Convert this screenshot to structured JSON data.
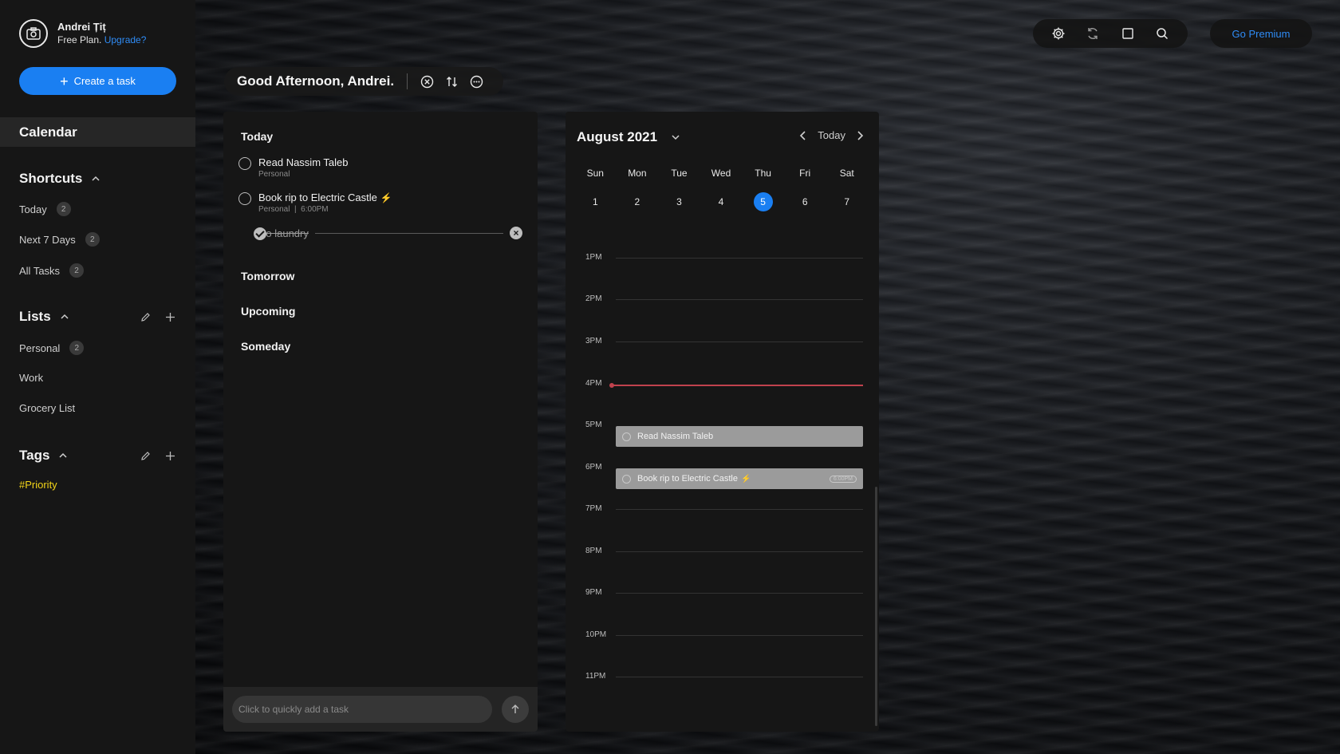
{
  "profile": {
    "name": "Andrei Țiț",
    "plan": "Free Plan.",
    "upgrade": "Upgrade?"
  },
  "sidebar": {
    "create_task": "Create a task",
    "calendar": "Calendar",
    "shortcuts_title": "Shortcuts",
    "shortcuts": [
      {
        "label": "Today",
        "count": "2"
      },
      {
        "label": "Next 7 Days",
        "count": "2"
      },
      {
        "label": "All Tasks",
        "count": "2"
      }
    ],
    "lists_title": "Lists",
    "lists": [
      {
        "label": "Personal",
        "count": "2"
      },
      {
        "label": "Work"
      },
      {
        "label": "Grocery List"
      }
    ],
    "tags_title": "Tags",
    "tags": [
      {
        "label": "#Priority",
        "color": "#f2d418"
      }
    ]
  },
  "greeting": {
    "text": "Good Afternoon, Andrei."
  },
  "toolbar": {
    "premium": "Go Premium",
    "icons": [
      "settings-icon",
      "sync-icon",
      "window-icon",
      "search-icon"
    ]
  },
  "tasks": {
    "groups": {
      "today": "Today",
      "tomorrow": "Tomorrow",
      "upcoming": "Upcoming",
      "someday": "Someday"
    },
    "items": [
      {
        "title": "Read Nassim Taleb",
        "meta": "Personal",
        "done": false
      },
      {
        "title": "Book rip to Electric Castle",
        "meta": "Personal  |  6:00PM",
        "done": false,
        "priority": "⚡"
      },
      {
        "title": "Do laundry",
        "done": true
      }
    ],
    "quick_add_placeholder": "Click to quickly add a task"
  },
  "calendar": {
    "month": "August 2021",
    "today_label": "Today",
    "weekdays": [
      "Sun",
      "Mon",
      "Tue",
      "Wed",
      "Thu",
      "Fri",
      "Sat"
    ],
    "dates": [
      "1",
      "2",
      "3",
      "4",
      "5",
      "6",
      "7"
    ],
    "selected_date": "5",
    "hours": [
      "1PM",
      "2PM",
      "3PM",
      "4PM",
      "5PM",
      "6PM",
      "7PM",
      "8PM",
      "9PM",
      "10PM",
      "11PM"
    ],
    "events": [
      {
        "title": "Read Nassim Taleb",
        "hour": "5PM"
      },
      {
        "title": "Book rip to Electric Castle",
        "hour": "6PM",
        "priority": "⚡",
        "time": "6:00PM"
      }
    ],
    "accent_color": "#1a7ff2",
    "now_line_color": "#c0424d"
  }
}
